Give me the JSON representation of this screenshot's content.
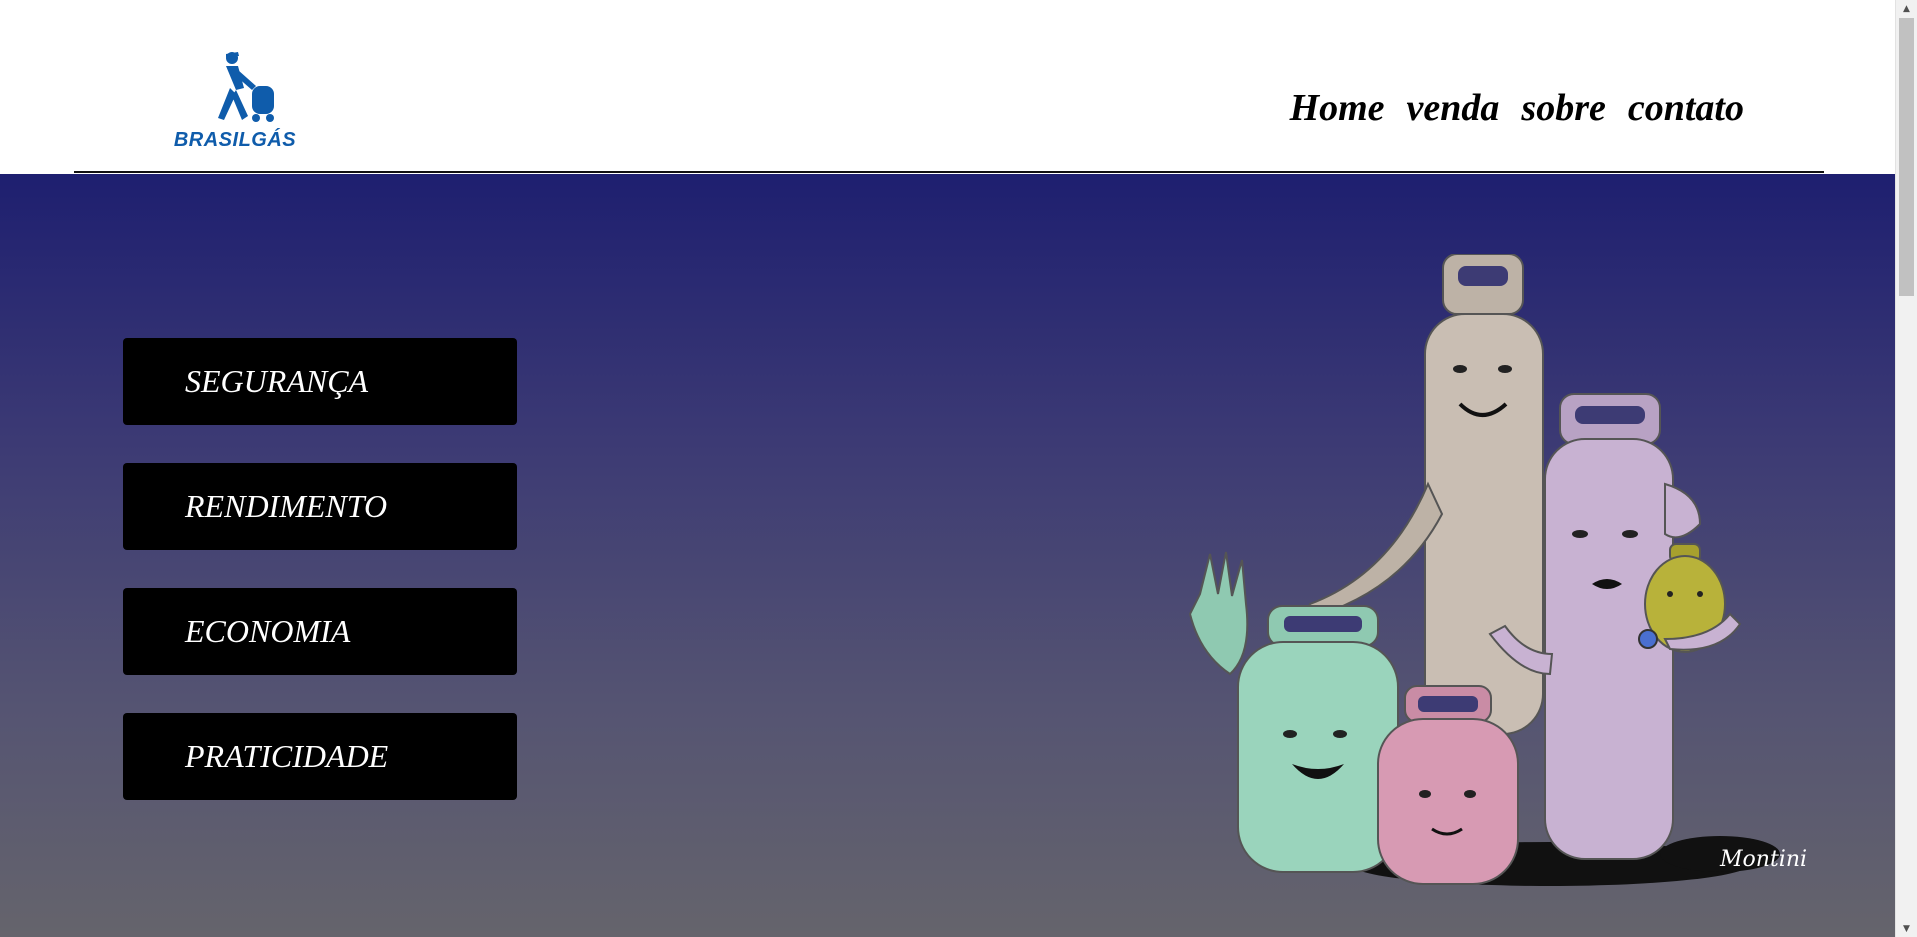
{
  "brand": {
    "name": "BRASILGÁS",
    "color": "#0f5cab"
  },
  "nav": {
    "items": [
      "Home",
      "venda",
      "sobre",
      "contato"
    ]
  },
  "hero": {
    "menu": [
      "SEGURANÇA",
      "RENDIMENTO",
      "ECONOMIA",
      "PRATICIDADE"
    ],
    "illustration_signature": "Montini"
  },
  "colors": {
    "hero_top": "#1e1f70",
    "hero_bottom": "#65646c",
    "button_bg": "#000000"
  },
  "scrollbar": {
    "up_icon": "▲",
    "down_icon": "▼"
  }
}
